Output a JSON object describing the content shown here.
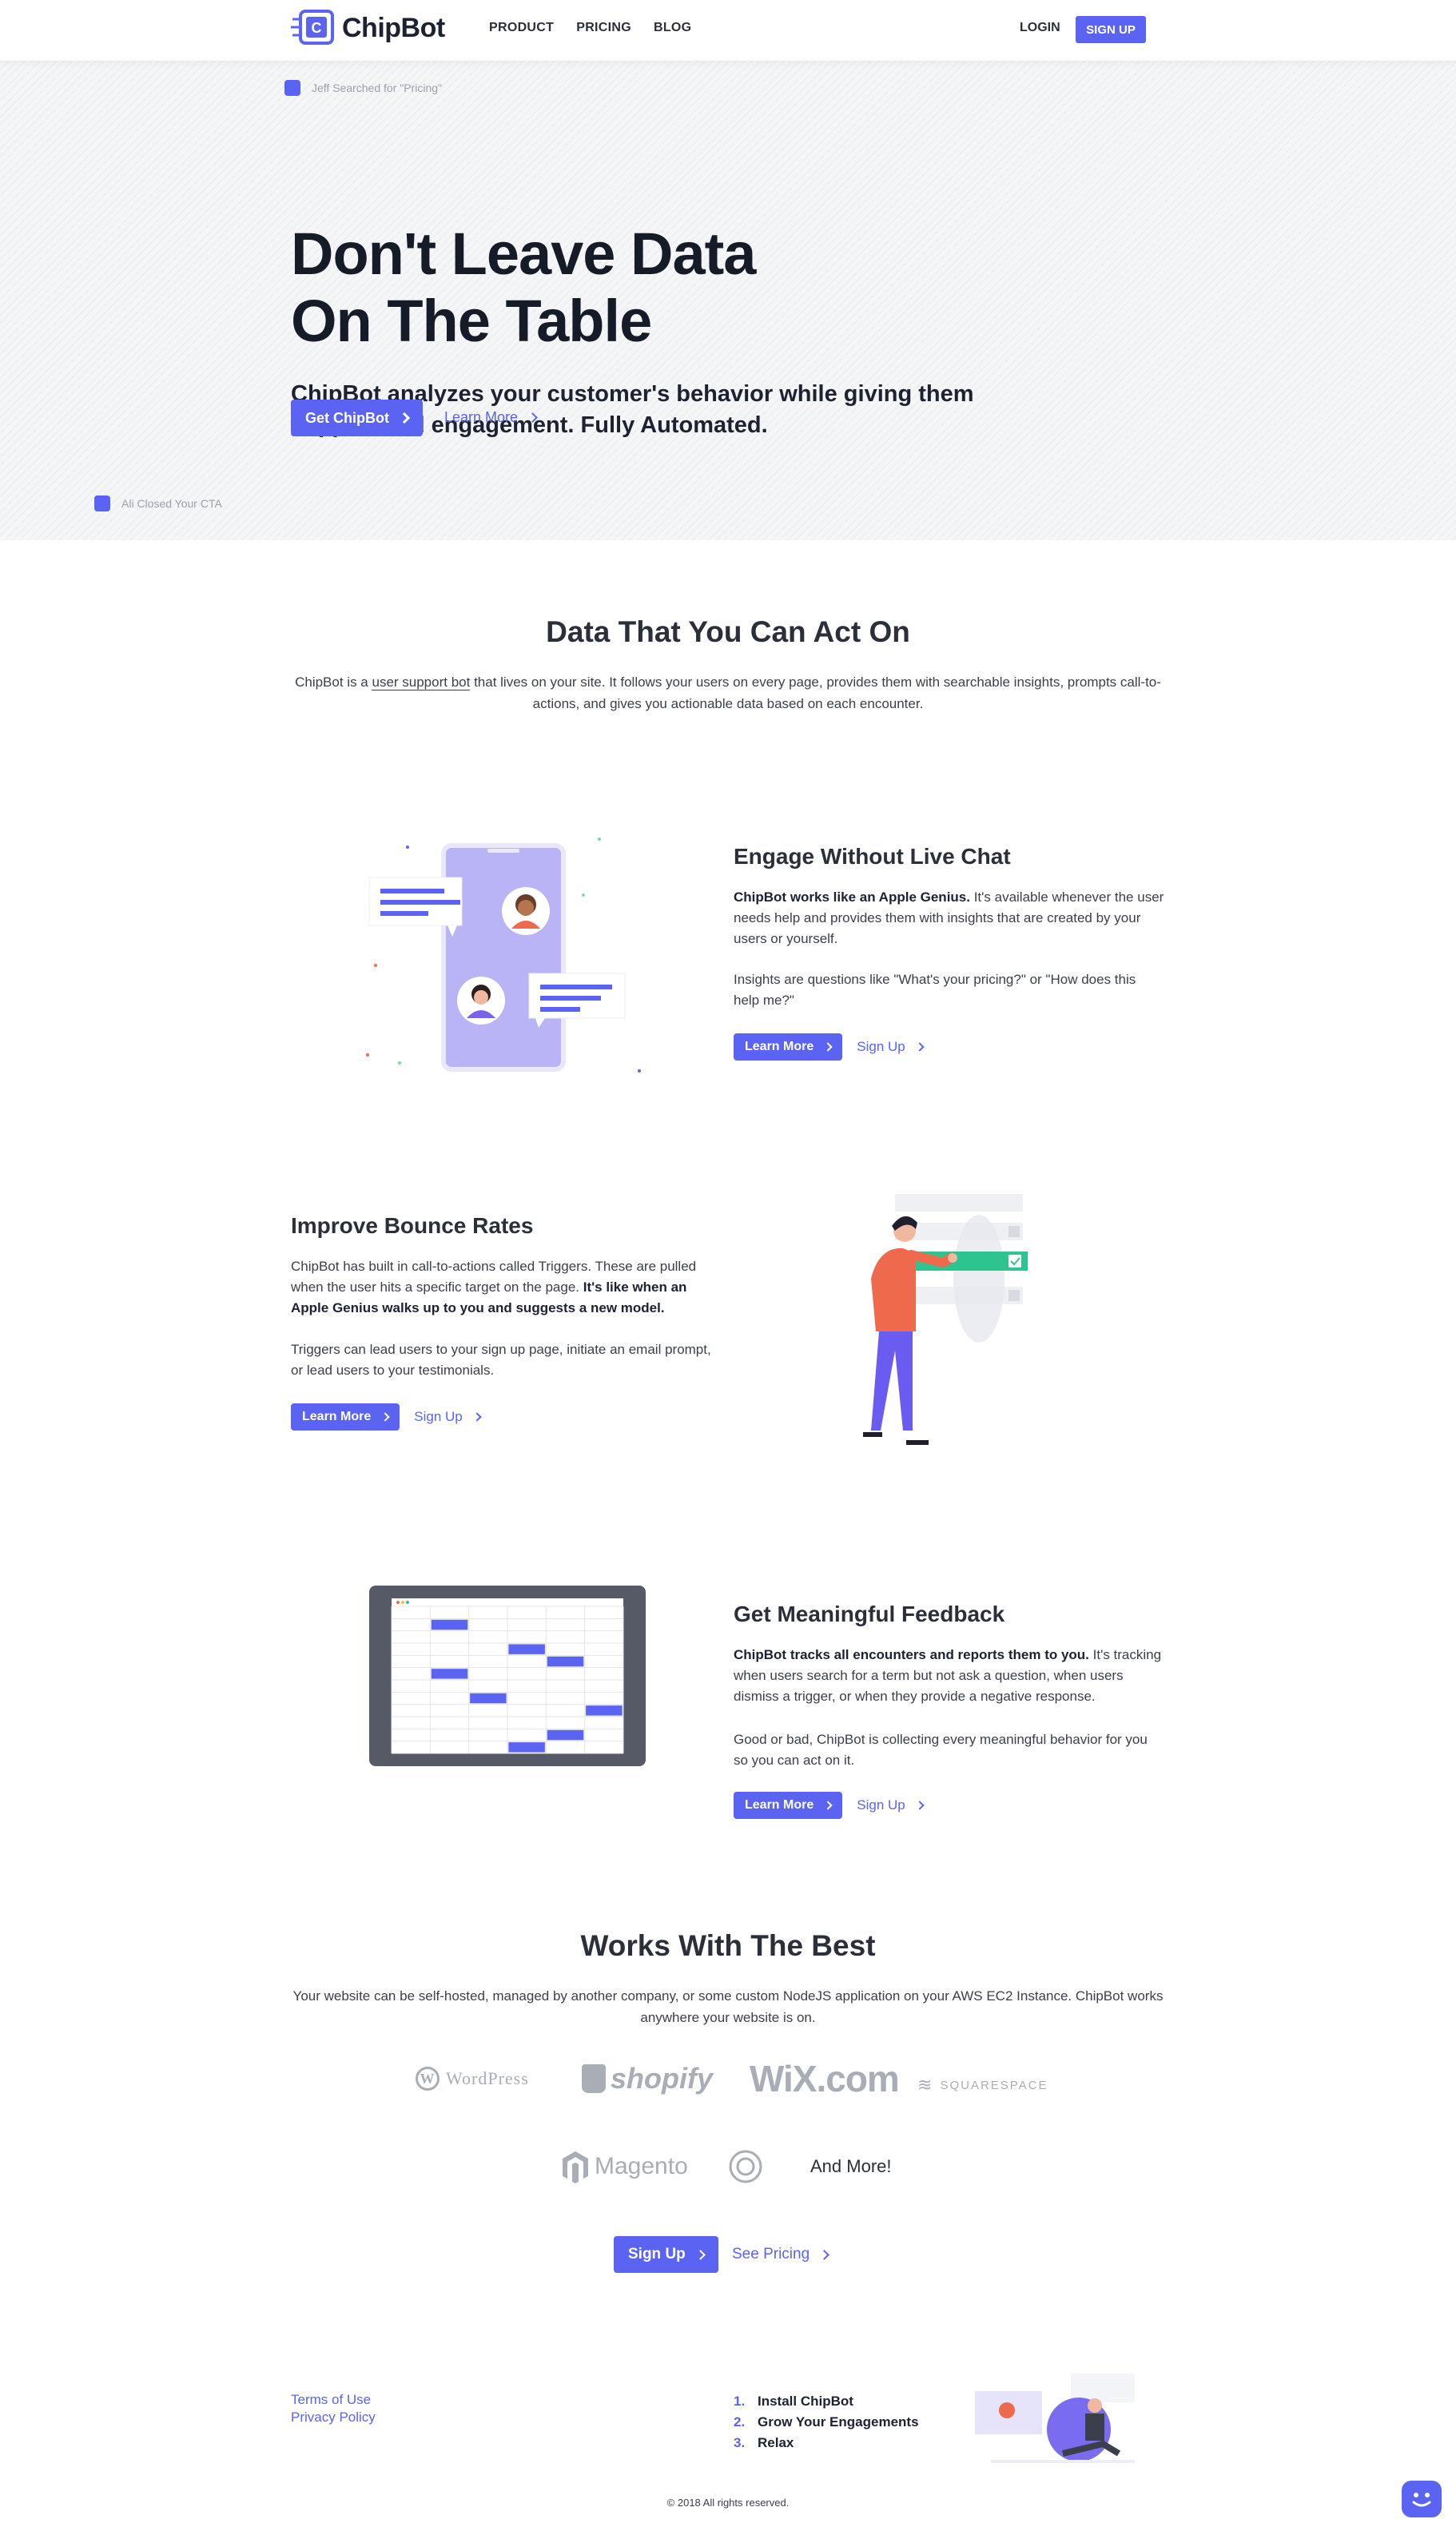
{
  "brand": {
    "name": "ChipBot",
    "accent": "#5b63f2"
  },
  "nav": {
    "links": [
      "PRODUCT",
      "PRICING",
      "BLOG"
    ],
    "login": "LOGIN",
    "signup": "SIGN UP"
  },
  "hero": {
    "notif_top": "Jeff Searched for \"Pricing\"",
    "title_line1": "Don't Leave Data",
    "title_line2": "On The Table",
    "subtitle": "ChipBot analyzes your customer's behavior while giving them support and engagement. Fully Automated.",
    "cta_primary": "Get ChipBot",
    "cta_secondary": "Learn More",
    "notif_bottom": "Ali Closed Your CTA"
  },
  "intro": {
    "title": "Data That You Can Act On",
    "text_pre": "ChipBot is a ",
    "text_link": "user support bot",
    "text_post": " that lives on your site. It follows your users on every page, provides them with searchable insights, prompts call-to-actions, and gives you actionable data based on each encounter."
  },
  "features": [
    {
      "title": "Engage Without Live Chat",
      "p1_bold": "ChipBot works like an Apple Genius.",
      "p1_rest": " It's available whenever the user needs help and provides them with insights that are created by your users or yourself.",
      "p2": "Insights are questions like \"What's your pricing?\" or \"How does this help me?\"",
      "learn": "Learn More",
      "signup": "Sign Up"
    },
    {
      "title": "Improve Bounce Rates",
      "p1_rest": "ChipBot has built in call-to-actions called Triggers. These are pulled when the user hits a specific target on the page. ",
      "p1_bold": "It's like when an Apple Genius walks up to you and suggests a new model.",
      "p2": "Triggers can lead users to your sign up page, initiate an email prompt, or lead users to your testimonials.",
      "learn": "Learn More",
      "signup": "Sign Up"
    },
    {
      "title": "Get Meaningful Feedback",
      "p1_bold": "ChipBot tracks all encounters and reports them to you.",
      "p1_rest": " It's tracking when users search for a term but not ask a question, when users dismiss a trigger, or when they provide a negative response.",
      "p2": "Good or bad, ChipBot is collecting every meaningful behavior for you so you can act on it.",
      "learn": "Learn More",
      "signup": "Sign Up"
    }
  ],
  "works": {
    "title": "Works With The Best",
    "text": "Your website can be self-hosted, managed by another company, or some custom NodeJS application on your AWS EC2 Instance. ChipBot works anywhere your website is on.",
    "partners": [
      "WordPress",
      "shopify",
      "WiX.com",
      "SQUARESPACE",
      "Magento"
    ],
    "and_more": "And More!",
    "signup": "Sign Up",
    "see_pricing": "See Pricing"
  },
  "footer": {
    "terms": "Terms of Use",
    "privacy": "Privacy Policy",
    "steps": [
      {
        "n": "1.",
        "label": "Install ChipBot"
      },
      {
        "n": "2.",
        "label": "Grow Your Engagements"
      },
      {
        "n": "3.",
        "label": "Relax"
      }
    ],
    "copyright": "© 2018 All rights reserved."
  }
}
